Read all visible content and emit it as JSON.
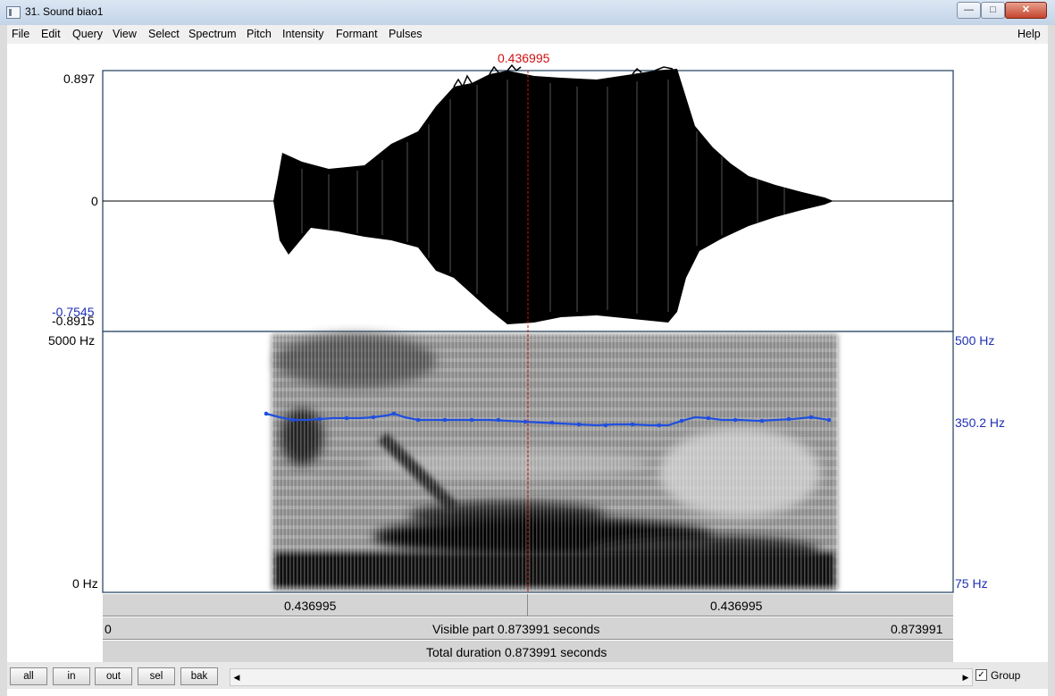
{
  "window": {
    "title": "31. Sound biao1",
    "min": "—",
    "max": "□",
    "close": "✕"
  },
  "menu": [
    "File",
    "Edit",
    "Query",
    "View",
    "Select",
    "Spectrum",
    "Pitch",
    "Intensity",
    "Formant",
    "Pulses"
  ],
  "help": "Help",
  "cursor": {
    "time_label": "0.436995"
  },
  "waveform": {
    "y_max": "0.897",
    "y_zero": "0",
    "y_min": "-0.8915",
    "y_min_blue": "-0.7545"
  },
  "spectrogram": {
    "freq_top": "5000 Hz",
    "freq_bottom": "0 Hz",
    "pitch_top": "500 Hz",
    "pitch_value": "350.2 Hz",
    "pitch_bottom": "75 Hz"
  },
  "bars": {
    "left_segment": "0.436995",
    "right_segment": "0.436995",
    "visible_start": "0",
    "visible_label": "Visible part 0.873991 seconds",
    "visible_end": "0.873991",
    "total_label": "Total duration 0.873991 seconds"
  },
  "buttons": {
    "all": "all",
    "in": "in",
    "out": "out",
    "sel": "sel",
    "bak": "bak"
  },
  "group": {
    "label": "Group",
    "checked": true,
    "mark": "✓"
  },
  "scroll": {
    "left": "◀",
    "right": "▶"
  },
  "colors": {
    "pitch": "#1f4fe0",
    "cursor": "#d01010",
    "label_blue": "#1f2fb5"
  }
}
